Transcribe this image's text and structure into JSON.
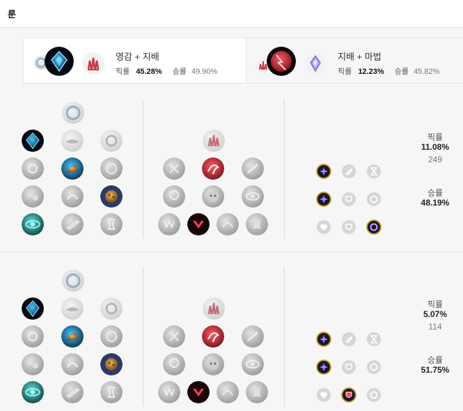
{
  "header": {
    "title": "룬"
  },
  "tabs": [
    {
      "name": "영감 + 지배",
      "pick_label": "픽률",
      "pick_rate": "45.28%",
      "win_label": "승률",
      "win_rate": "49.90%"
    },
    {
      "name": "지배 + 마법",
      "pick_label": "픽률",
      "pick_rate": "12.23%",
      "win_label": "승률",
      "win_rate": "45.82%"
    }
  ],
  "builds": [
    {
      "pick_label": "픽률",
      "pick_rate": "11.08%",
      "games": "249",
      "win_label": "승률",
      "win_rate": "48.19%"
    },
    {
      "pick_label": "픽률",
      "pick_rate": "5.07%",
      "games": "114",
      "win_label": "승률",
      "win_rate": "51.75%"
    }
  ],
  "colors": {
    "inspiration": "#3aa7d9",
    "domination": "#c53a45",
    "sorcery": "#9b7be0",
    "shard_ring": "#c9a227",
    "inactive": "#9c9c9c"
  }
}
